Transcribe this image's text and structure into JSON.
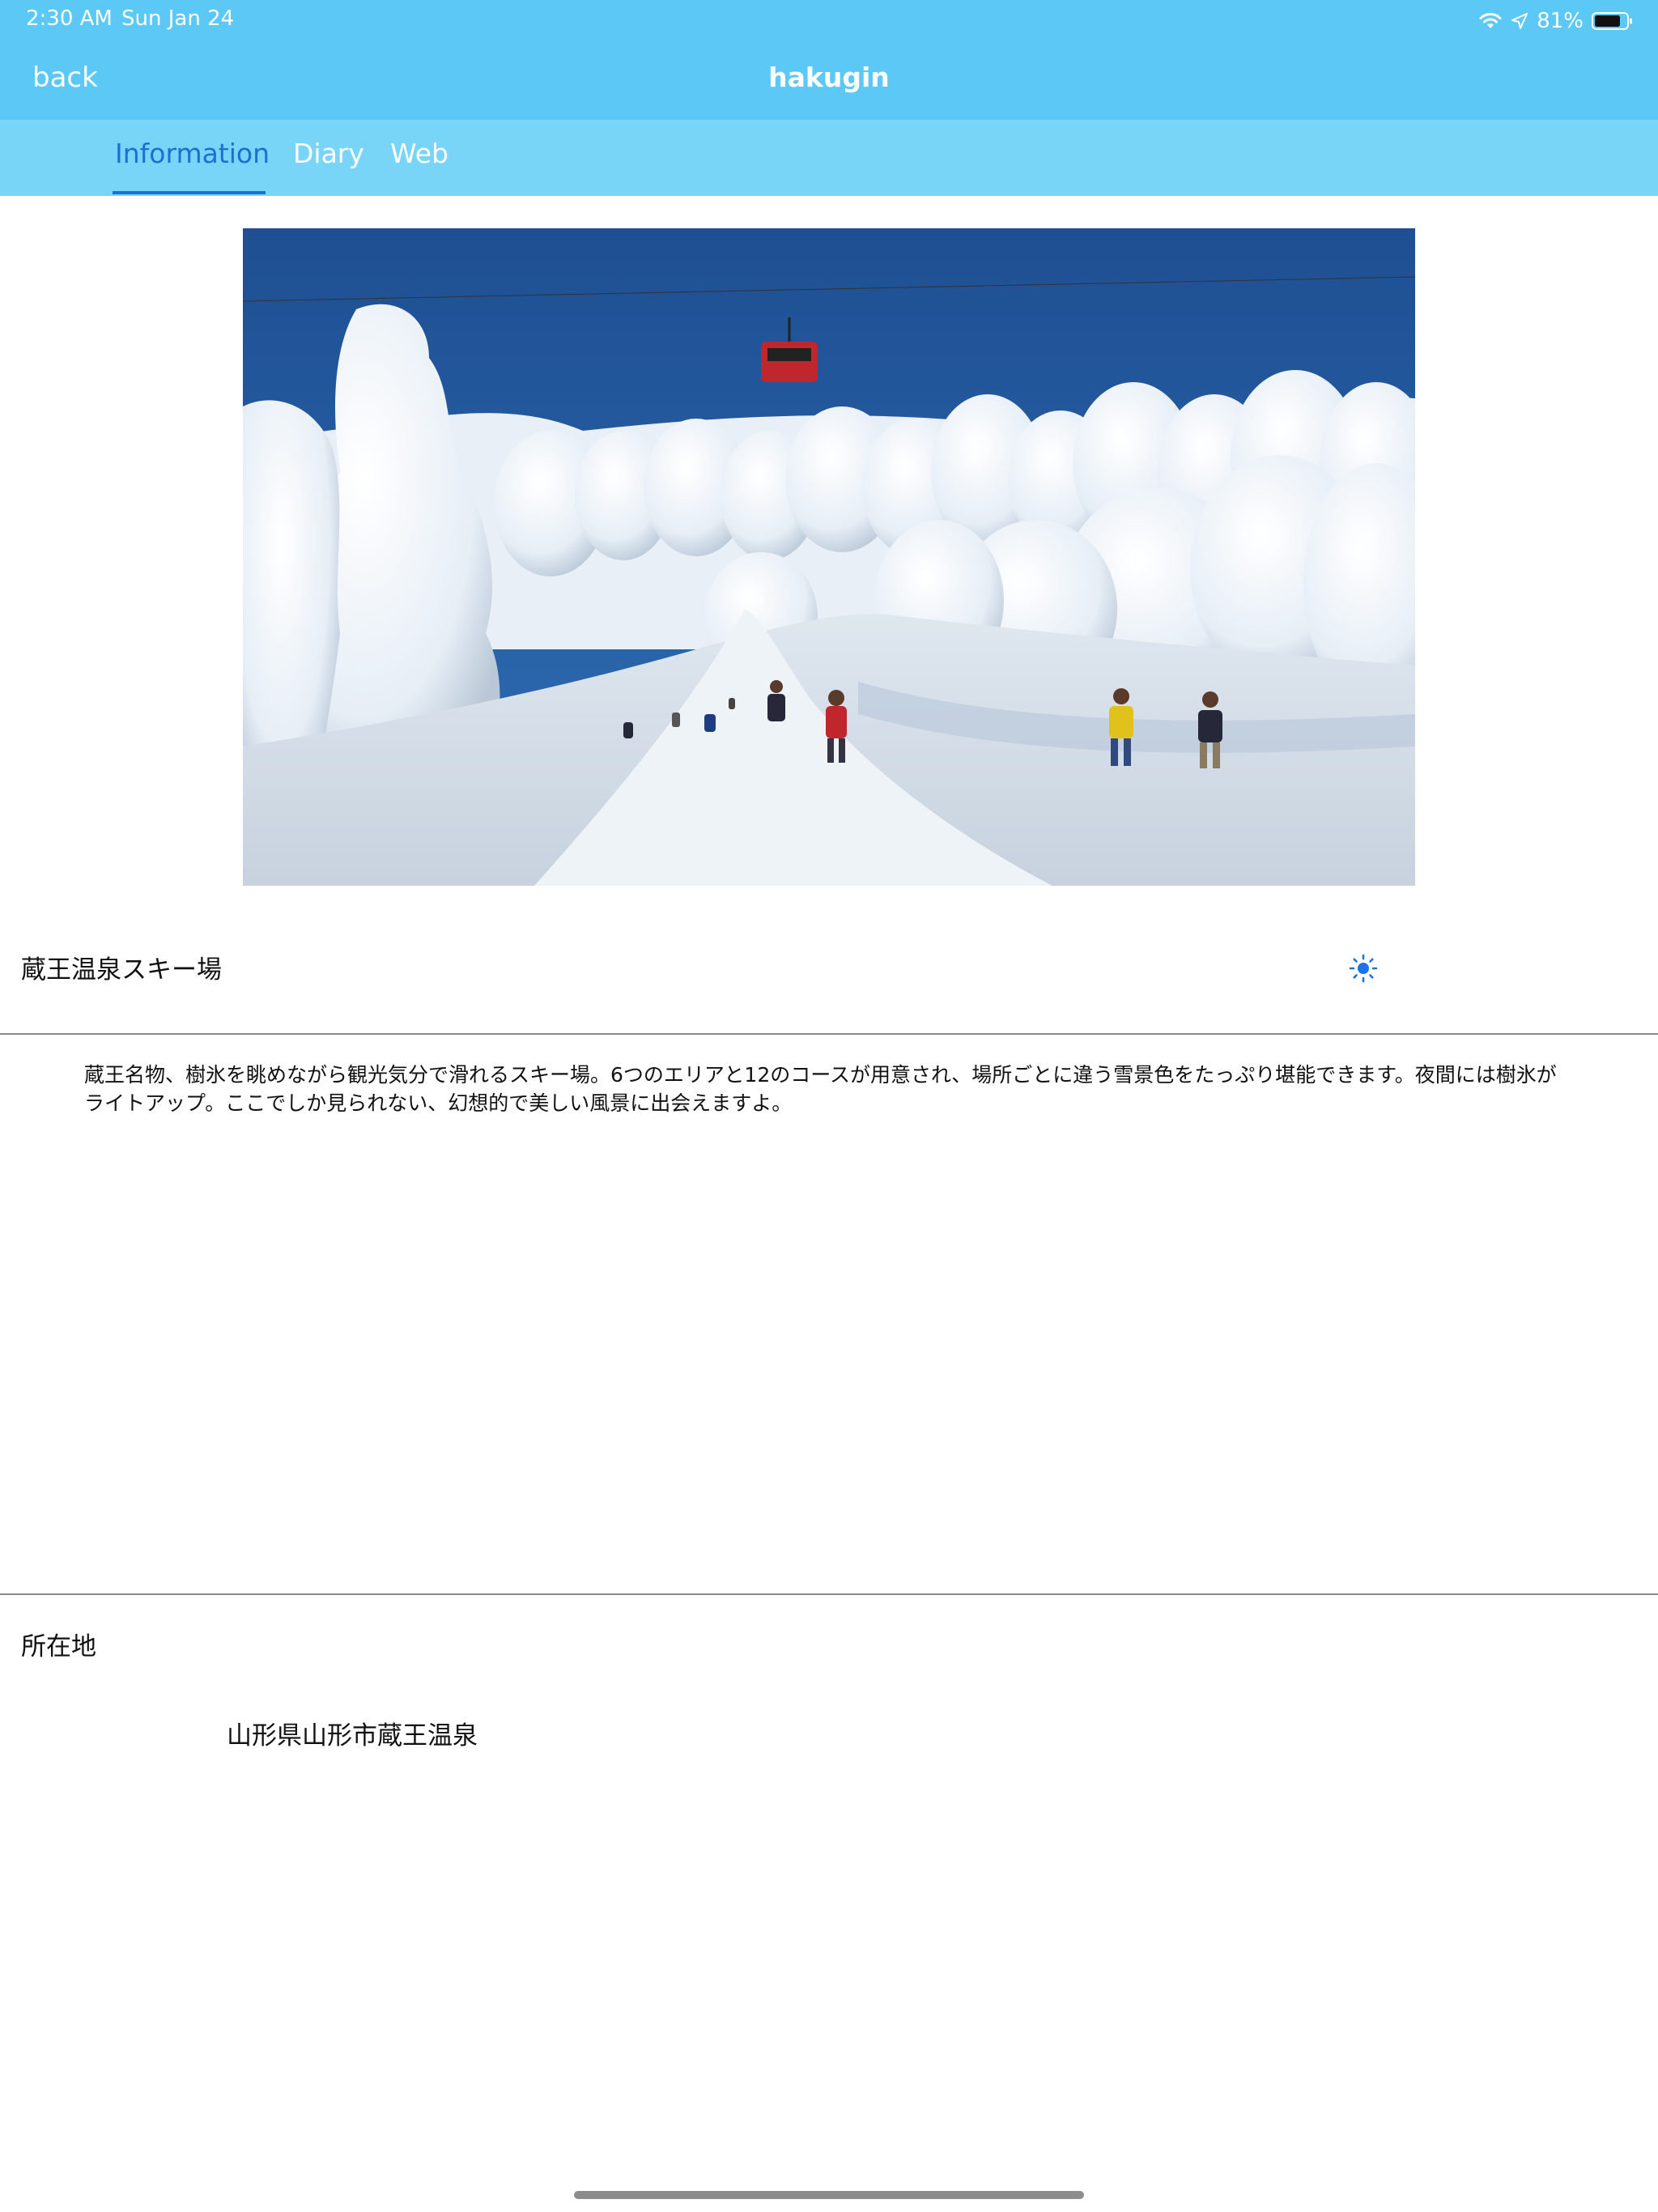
{
  "status_bar": {
    "time": "2:30 AM",
    "date": "Sun Jan 24",
    "battery": "81%",
    "icons": [
      "wifi-icon",
      "location-arrow-icon",
      "battery-icon"
    ]
  },
  "nav": {
    "back_label": "back",
    "title": "hakugin"
  },
  "tabs": [
    {
      "label": "Information",
      "selected": true
    },
    {
      "label": "Diary",
      "selected": false
    },
    {
      "label": "Web",
      "selected": false
    }
  ],
  "content": {
    "photo_icon": "snow-monster-ski-slope-photo",
    "spot_name": "蔵王温泉スキー場",
    "weather_icon": "sun-icon",
    "description": "蔵王名物、樹氷を眺めながら観光気分で滑れるスキー場。6つのエリアと12のコースが用意され、場所ごとに違う雪景色をたっぷり堪能できます。夜間には樹氷がライトアップ。ここでしか見られない、幻想的で美しい風景に出会えますよ。",
    "location_label": "所在地",
    "location_value": "山形県山形市蔵王温泉"
  },
  "colors": {
    "nav_bar": "#5bc8f5",
    "tab_bar": "#79d5f7",
    "tab_selected": "#1e6fd0",
    "weather_icon": "#1a73e8"
  }
}
